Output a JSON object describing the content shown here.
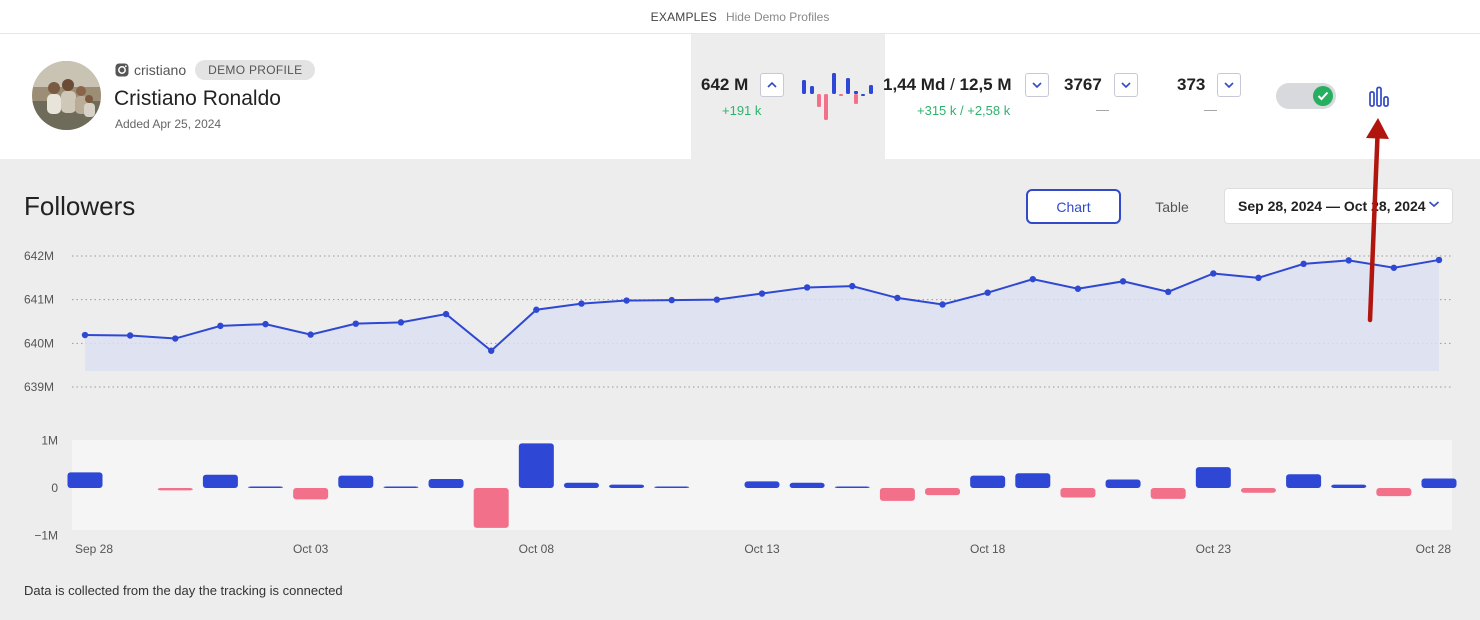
{
  "topbar": {
    "examples": "EXAMPLES",
    "hide_demo": "Hide Demo Profiles"
  },
  "profile": {
    "platform_icon": "instagram-icon",
    "handle": "cristiano",
    "badge": "DEMO PROFILE",
    "name": "Cristiano Ronaldo",
    "added": "Added Apr 25, 2024"
  },
  "stats": {
    "followers": {
      "value": "642 M",
      "delta": "+191 k"
    },
    "likes": {
      "value_a": "1,44 Md",
      "sep": " / ",
      "value_b": "12,5 M",
      "delta": "+315 k / +2,58 k"
    },
    "posts": {
      "value": "3767",
      "delta": "—"
    },
    "following": {
      "value": "373",
      "delta": "—"
    }
  },
  "colors": {
    "accent": "#3249c8",
    "positive": "#2eb36c",
    "negative": "#f2708a",
    "bar_pos": "#2e47d4",
    "arrow": "#b0160e"
  },
  "section": {
    "title": "Followers",
    "tab_chart": "Chart",
    "tab_table": "Table",
    "date_range": "Sep 28, 2024 — Oct 28, 2024"
  },
  "footnote": "Data is collected from the day the tracking is connected",
  "chart_data": [
    {
      "type": "line",
      "title": "",
      "ylabel": "",
      "ylim": [
        638.8,
        642.2
      ],
      "yticks": [
        "642M",
        "641M",
        "640M",
        "639M"
      ],
      "ytick_values": [
        642,
        641,
        640,
        639
      ],
      "x": [
        "Sep 28",
        "Sep 29",
        "Sep 30",
        "Oct 01",
        "Oct 02",
        "Oct 03",
        "Oct 04",
        "Oct 05",
        "Oct 06",
        "Oct 07",
        "Oct 08",
        "Oct 09",
        "Oct 10",
        "Oct 11",
        "Oct 12",
        "Oct 13",
        "Oct 14",
        "Oct 15",
        "Oct 16",
        "Oct 17",
        "Oct 18",
        "Oct 19",
        "Oct 20",
        "Oct 21",
        "Oct 22",
        "Oct 23",
        "Oct 24",
        "Oct 25",
        "Oct 26",
        "Oct 27",
        "Oct 28"
      ],
      "series": [
        {
          "values": [
            640.19,
            640.18,
            640.11,
            640.4,
            640.44,
            640.2,
            640.45,
            640.48,
            640.67,
            639.83,
            640.77,
            640.91,
            640.98,
            640.99,
            641.0,
            641.14,
            641.28,
            641.31,
            641.04,
            640.89,
            641.16,
            641.47,
            641.25,
            641.42,
            641.18,
            641.6,
            641.5,
            641.82,
            641.9,
            641.73,
            641.91
          ]
        }
      ],
      "grid": true
    },
    {
      "type": "bar",
      "title": "",
      "ylim": [
        -1,
        1
      ],
      "yticks": [
        "1M",
        "0",
        "−1M"
      ],
      "ytick_values": [
        1,
        0,
        -1
      ],
      "categories": [
        "Sep 28",
        "Sep 29",
        "Sep 30",
        "Oct 01",
        "Oct 02",
        "Oct 03",
        "Oct 04",
        "Oct 05",
        "Oct 06",
        "Oct 07",
        "Oct 08",
        "Oct 09",
        "Oct 10",
        "Oct 11",
        "Oct 12",
        "Oct 13",
        "Oct 14",
        "Oct 15",
        "Oct 16",
        "Oct 17",
        "Oct 18",
        "Oct 19",
        "Oct 20",
        "Oct 21",
        "Oct 22",
        "Oct 23",
        "Oct 24",
        "Oct 25",
        "Oct 26",
        "Oct 27",
        "Oct 28"
      ],
      "xtick_labels": [
        "Sep 28",
        "Oct 03",
        "Oct 08",
        "Oct 13",
        "Oct 18",
        "Oct 23",
        "Oct 28"
      ],
      "xtick_indices": [
        0,
        5,
        10,
        15,
        20,
        25,
        30
      ],
      "values": [
        0.33,
        0,
        -0.05,
        0.28,
        0.02,
        -0.24,
        0.26,
        0.02,
        0.19,
        -0.84,
        0.94,
        0.11,
        0.07,
        0.01,
        0,
        0.14,
        0.11,
        0.03,
        -0.27,
        -0.15,
        0.26,
        0.31,
        -0.2,
        0.18,
        -0.23,
        0.44,
        -0.1,
        0.29,
        0.07,
        -0.17,
        0.2
      ],
      "grid": false
    }
  ]
}
